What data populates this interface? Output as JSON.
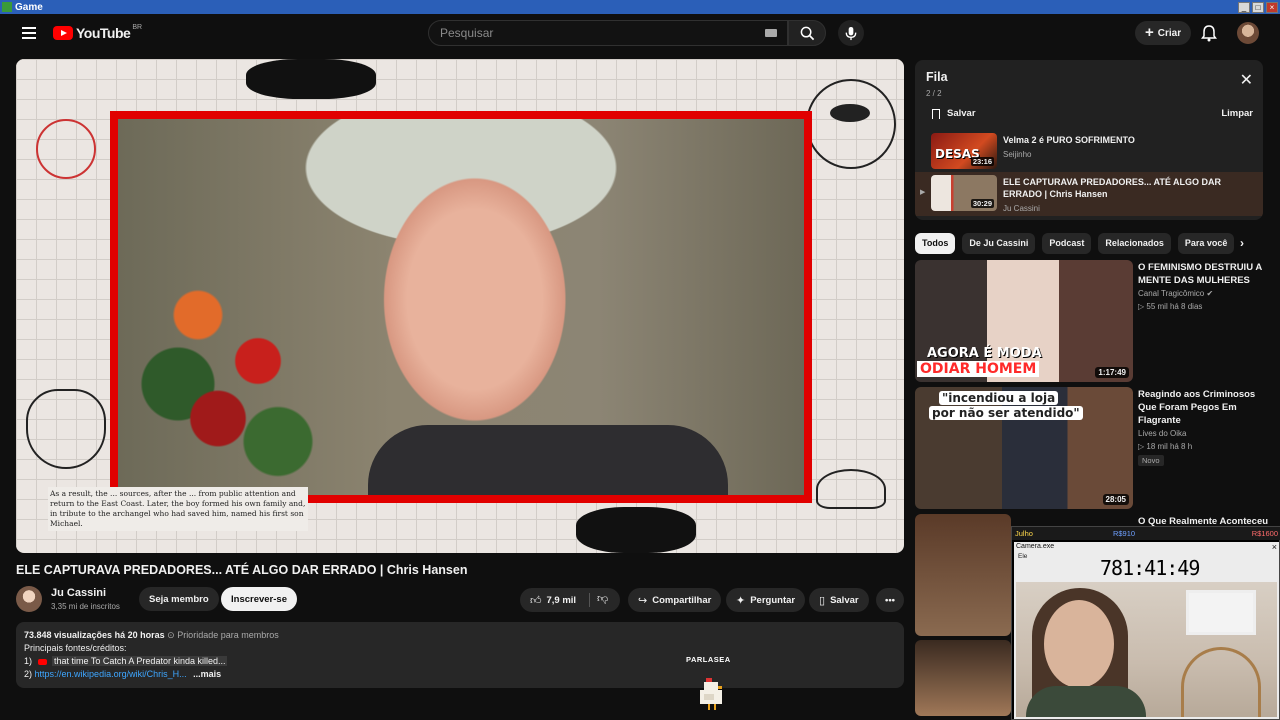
{
  "window": {
    "title": "Game"
  },
  "header": {
    "logo_text": "YouTube",
    "region": "BR",
    "search_placeholder": "Pesquisar",
    "create_label": "Criar"
  },
  "video": {
    "caption": "As a result, the ... sources, after the ... from public attention and return to the East Coast. Later, the boy formed his own family and, in tribute to the archangel who had saved him, named his first son Michael.",
    "title": "ELE CAPTURAVA PREDADORES... ATÉ ALGO DAR ERRADO | Chris Hansen"
  },
  "channel": {
    "name": "Ju Cassini",
    "subs": "3,35 mi de inscritos",
    "member_label": "Seja membro",
    "subscribe_label": "Inscrever-se"
  },
  "actions": {
    "likes": "7,9 mil",
    "share": "Compartilhar",
    "ask": "Perguntar",
    "save": "Salvar"
  },
  "description": {
    "views": "73.848 visualizações",
    "time": "há 20 horas",
    "priority": "Prioridade para membros",
    "sources_label": "Principais fontes/créditos:",
    "item1_num": "1)",
    "item1_text": "that time To Catch A Predator kinda killed...",
    "item2_num": "2)",
    "item2_link": "https://en.wikipedia.org/wiki/Chris_H...",
    "more": "...mais"
  },
  "overlay_text": {
    "parlasea": "PARLASEA"
  },
  "queue": {
    "title": "Fila",
    "count": "2 / 2",
    "save": "Salvar",
    "clear": "Limpar",
    "items": [
      {
        "title": "Velma 2 é PURO SOFRIMENTO",
        "channel": "Seijinho",
        "duration": "23:16",
        "thumb_text": "DESAS"
      },
      {
        "title": "ELE CAPTURAVA PREDADORES... ATÉ ALGO DAR ERRADO | Chris Hansen",
        "channel": "Ju Cassini",
        "duration": "30:29"
      }
    ]
  },
  "chips": [
    "Todos",
    "De Ju Cassini",
    "Podcast",
    "Relacionados",
    "Para você"
  ],
  "recommendations": [
    {
      "title": "O FEMINISMO DESTRUIU A MENTE DAS MULHERES",
      "channel": "Canal Tragicômico",
      "meta": "▷ 55 mil  há 8 dias",
      "duration": "1:17:49",
      "thumb_line1": "AGORA É MODA",
      "thumb_line2": "ODIAR HOMEM"
    },
    {
      "title": "Reagindo aos Criminosos Que Foram Pegos Em Flagrante",
      "channel": "Lives do Oika",
      "meta": "▷ 18 mil  há 8 h",
      "badge": "Novo",
      "duration": "28:05",
      "thumb_line1": "\"incendiou a loja",
      "thumb_line2": "por não ser atendido\""
    },
    {
      "title": "O Que Realmente Aconteceu"
    }
  ],
  "stream_overlay": {
    "label": "Julho",
    "currency_mid": "R$910",
    "currency_right": "R$1600",
    "window_title": "Camera.exe",
    "window_sub": "Ele",
    "timer": "781:41:49"
  }
}
